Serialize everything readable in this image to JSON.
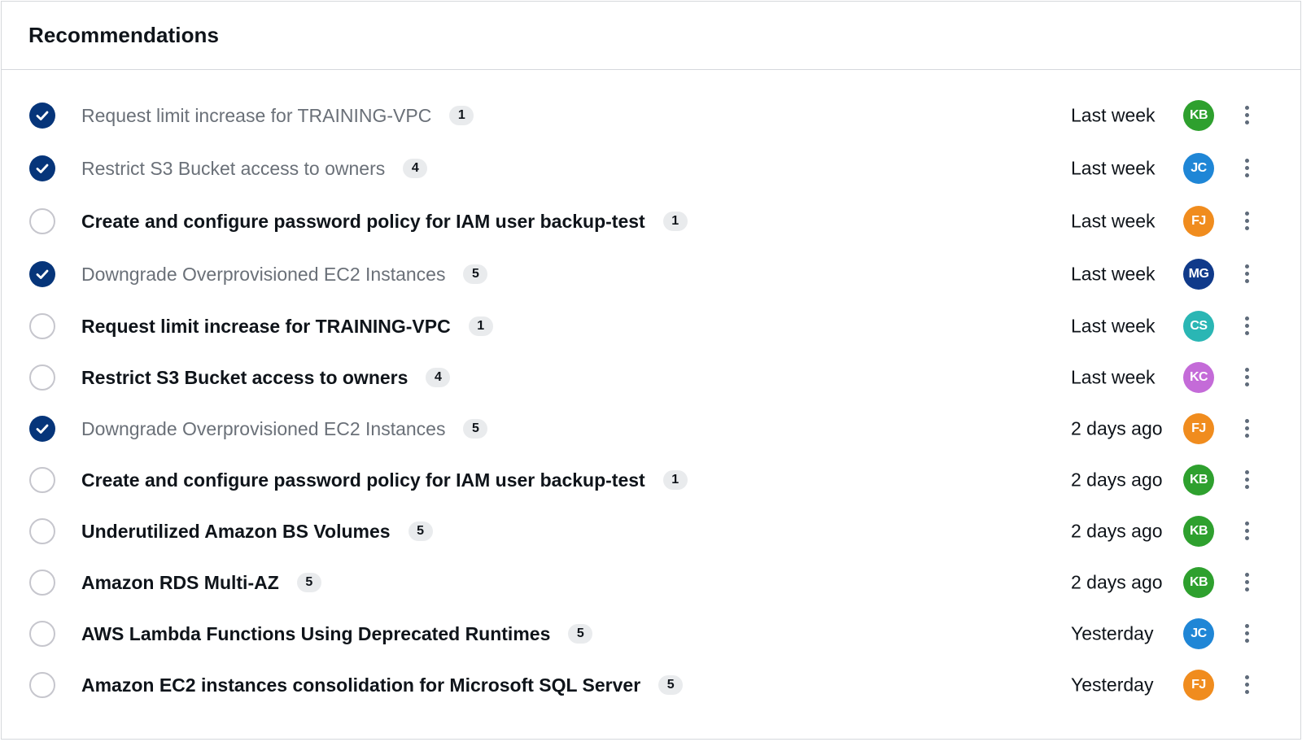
{
  "panel": {
    "title": "Recommendations"
  },
  "items": [
    {
      "checked": true,
      "title": "Request limit increase for TRAINING-VPC",
      "count": "1",
      "when": "Last week",
      "assignee": "KB",
      "color": "#2ea02e"
    },
    {
      "checked": true,
      "title": "Restrict S3 Bucket access to owners",
      "count": "4",
      "when": "Last week",
      "assignee": "JC",
      "color": "#1f86d6"
    },
    {
      "checked": false,
      "title": "Create and configure password policy for IAM user backup-test",
      "count": "1",
      "when": "Last week",
      "assignee": "FJ",
      "color": "#f08c1e"
    },
    {
      "checked": true,
      "title": "Downgrade Overprovisioned EC2 Instances",
      "count": "5",
      "when": "Last week",
      "assignee": "MG",
      "color": "#103a8a"
    },
    {
      "checked": false,
      "title": "Request limit increase for TRAINING-VPC",
      "count": "1",
      "when": "Last week",
      "assignee": "CS",
      "color": "#2ab6b4"
    },
    {
      "checked": false,
      "title": "Restrict S3 Bucket access to owners",
      "count": "4",
      "when": "Last week",
      "assignee": "KC",
      "color": "#c46bd8"
    },
    {
      "checked": true,
      "title": "Downgrade Overprovisioned EC2 Instances",
      "count": "5",
      "when": "2 days ago",
      "assignee": "FJ",
      "color": "#f08c1e"
    },
    {
      "checked": false,
      "title": "Create and configure password policy for IAM user backup-test",
      "count": "1",
      "when": "2 days ago",
      "assignee": "KB",
      "color": "#2ea02e"
    },
    {
      "checked": false,
      "title": "Underutilized Amazon BS Volumes",
      "count": "5",
      "when": "2 days ago",
      "assignee": "KB",
      "color": "#2ea02e"
    },
    {
      "checked": false,
      "title": "Amazon RDS Multi-AZ",
      "count": "5",
      "when": "2 days ago",
      "assignee": "KB",
      "color": "#2ea02e"
    },
    {
      "checked": false,
      "title": "AWS Lambda Functions Using Deprecated Runtimes",
      "count": "5",
      "when": "Yesterday",
      "assignee": "JC",
      "color": "#1f86d6"
    },
    {
      "checked": false,
      "title": "Amazon EC2 instances consolidation for Microsoft SQL Server",
      "count": "5",
      "when": "Yesterday",
      "assignee": "FJ",
      "color": "#f08c1e"
    }
  ],
  "icons": {
    "check": "check-icon",
    "menu": "more-vertical-icon"
  }
}
